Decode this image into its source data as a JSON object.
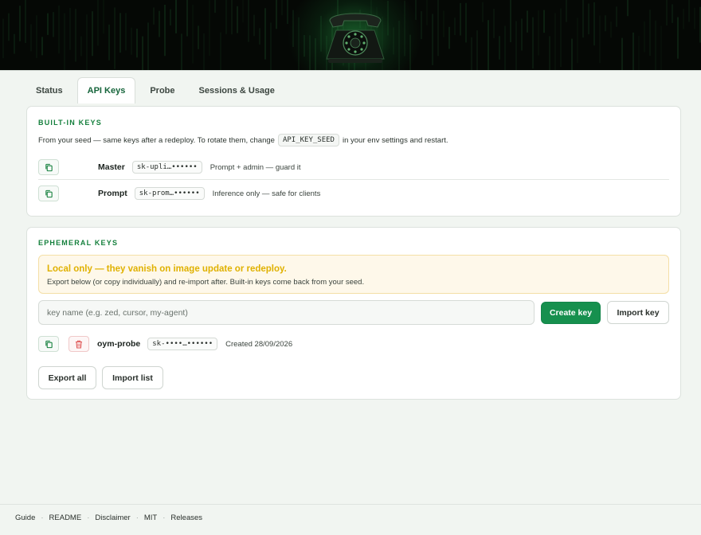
{
  "tabs": [
    {
      "label": "Status",
      "active": false
    },
    {
      "label": "API Keys",
      "active": true
    },
    {
      "label": "Probe",
      "active": false
    },
    {
      "label": "Sessions & Usage",
      "active": false
    }
  ],
  "builtin": {
    "title": "BUILT-IN KEYS",
    "desc_before": "From your seed — same keys after a redeploy. To rotate them, change",
    "desc_code": "API_KEY_SEED",
    "desc_after": "in your env settings and restart.",
    "keys": [
      {
        "name": "Master",
        "value": "sk-upli…••••••",
        "note": "Prompt + admin — guard it",
        "icon": "copy-icon"
      },
      {
        "name": "Prompt",
        "value": "sk-prom…••••••",
        "note": "Inference only — safe for clients",
        "icon": "copy-icon"
      }
    ]
  },
  "ephemeral": {
    "title": "EPHEMERAL KEYS",
    "warning_title": "Local only — they vanish on image update or redeploy.",
    "warning_text": "Export below (or copy individually) and re-import after. Built-in keys come back from your seed.",
    "input_placeholder": "key name (e.g. zed, cursor, my-agent)",
    "create_label": "Create key",
    "import_key_label": "Import key",
    "keys": [
      {
        "name": "oym-probe",
        "value": "sk-••••…••••••",
        "created": "Created 28/09/2026"
      }
    ],
    "export_all_label": "Export all",
    "import_list_label": "Import list"
  },
  "footer": [
    "Guide",
    "README",
    "Disclaimer",
    "MIT",
    "Releases"
  ],
  "colors": {
    "accent": "#15803d",
    "primary_button": "#16904e",
    "warning_title": "#e0b100",
    "danger": "#e05a5a"
  }
}
